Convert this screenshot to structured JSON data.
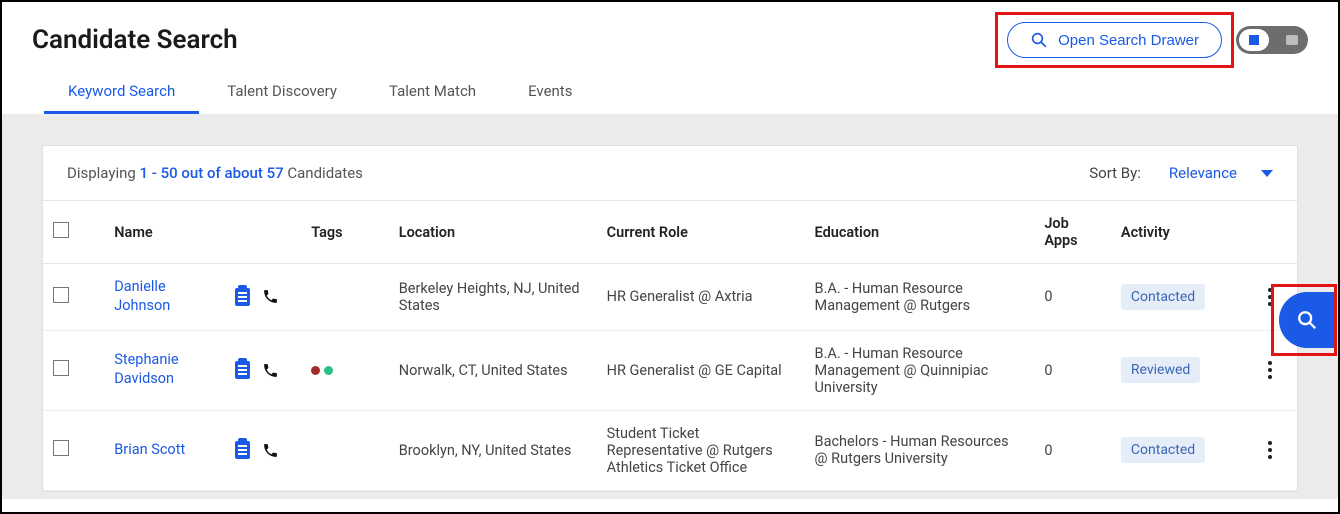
{
  "header": {
    "title": "Candidate Search",
    "open_search_label": "Open Search Drawer"
  },
  "tabs": [
    {
      "label": "Keyword Search",
      "active": true
    },
    {
      "label": "Talent Discovery",
      "active": false
    },
    {
      "label": "Talent Match",
      "active": false
    },
    {
      "label": "Events",
      "active": false
    }
  ],
  "results_summary": {
    "prefix": "Displaying ",
    "range": "1 - 50 out of about 57",
    "suffix": " Candidates"
  },
  "sort": {
    "label": "Sort By:",
    "value": "Relevance"
  },
  "columns": {
    "name": "Name",
    "tags": "Tags",
    "location": "Location",
    "current_role": "Current Role",
    "education": "Education",
    "job_apps": "Job Apps",
    "activity": "Activity"
  },
  "rows": [
    {
      "name": "Danielle Johnson",
      "tag_dots": [],
      "location": "Berkeley Heights, NJ, United States",
      "role": "HR Generalist @ Axtria",
      "education": "B.A. - Human Resource Management @ Rutgers",
      "apps": "0",
      "activity": "Contacted"
    },
    {
      "name": "Stephanie Davidson",
      "tag_dots": [
        "#a02b2b",
        "#2bbf87"
      ],
      "location": "Norwalk, CT, United States",
      "role": "HR Generalist @ GE Capital",
      "education": "B.A. - Human Resource Management @ Quinnipiac University",
      "apps": "0",
      "activity": "Reviewed"
    },
    {
      "name": "Brian Scott",
      "tag_dots": [],
      "location": "Brooklyn, NY, United States",
      "role": "Student Ticket Representative @ Rutgers Athletics Ticket Office",
      "education": "Bachelors - Human Resources @ Rutgers University",
      "apps": "0",
      "activity": "Contacted"
    }
  ],
  "colors": {
    "accent": "#1a5ae6",
    "highlight": "#e11313",
    "badge_bg": "#e5edf9",
    "badge_fg": "#3c66b5"
  }
}
